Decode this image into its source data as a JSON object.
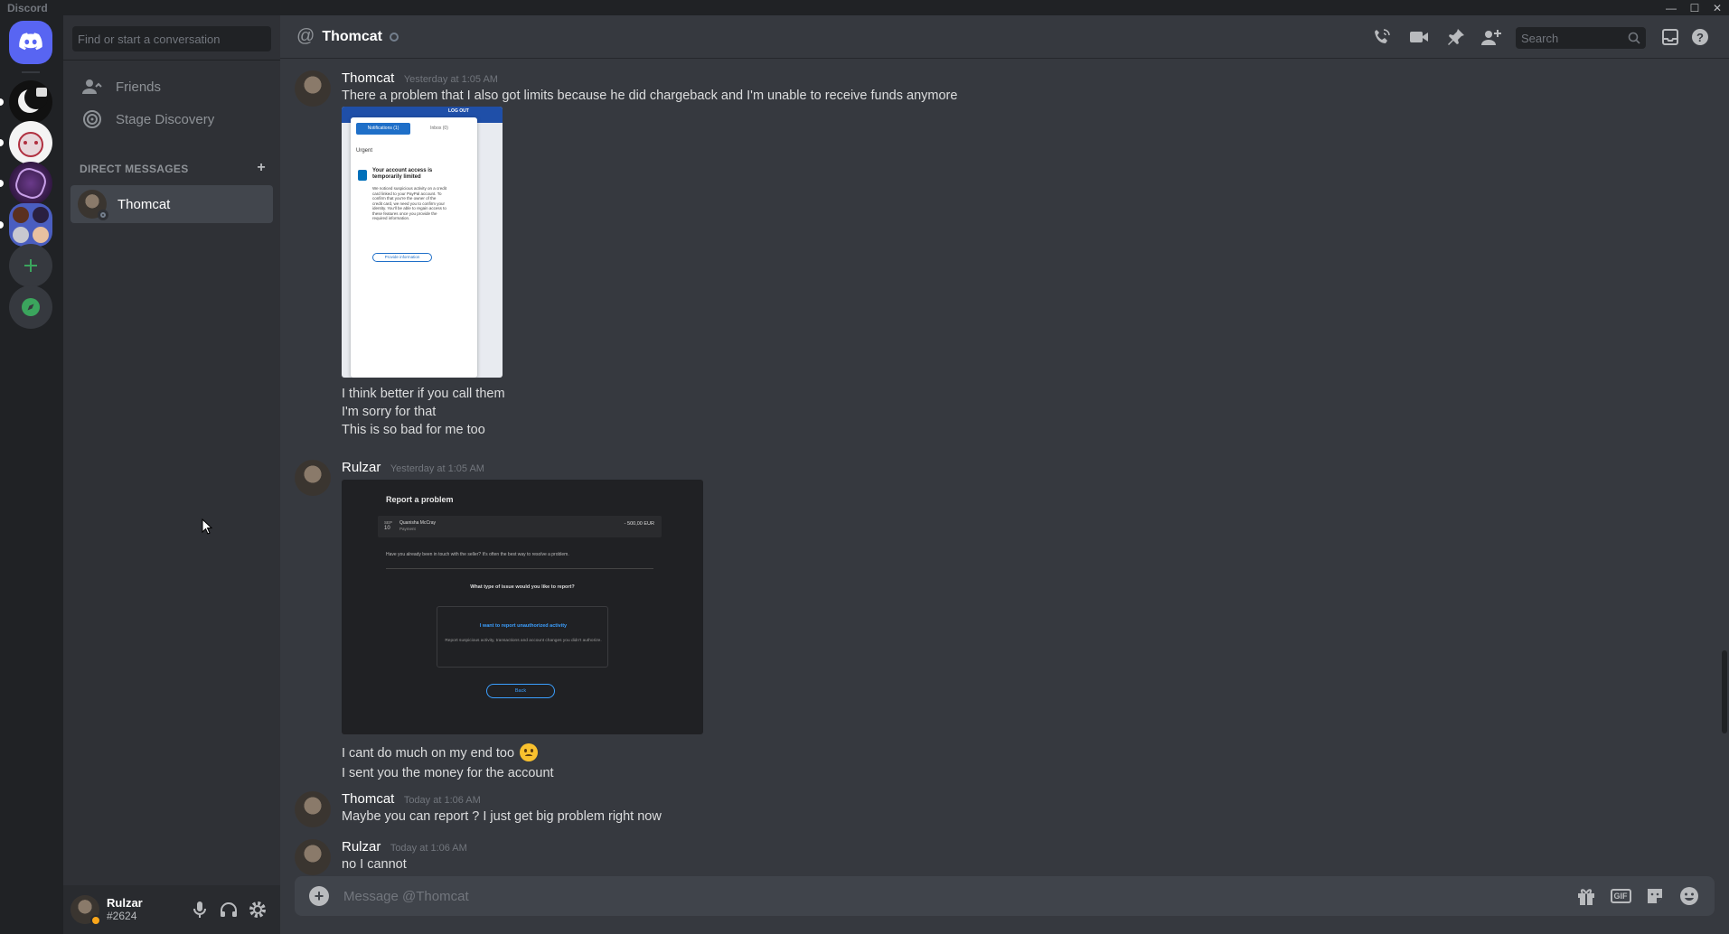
{
  "app": {
    "name": "Discord"
  },
  "guilds": {
    "items": [
      {
        "name": "home"
      },
      {
        "name": "server-moon"
      },
      {
        "name": "server-fox"
      },
      {
        "name": "server-purple"
      },
      {
        "name": "server-group"
      }
    ],
    "add_server_icon": "plus-icon",
    "explore_icon": "compass-icon"
  },
  "sidebar": {
    "search_placeholder": "Find or start a conversation",
    "nav": [
      {
        "label": "Friends",
        "icon": "friends-icon"
      },
      {
        "label": "Stage Discovery",
        "icon": "stage-icon"
      }
    ],
    "dm_header": "DIRECT MESSAGES",
    "dms": [
      {
        "name": "Thomcat",
        "status": "offline"
      }
    ]
  },
  "user": {
    "name": "Rulzar",
    "tag": "#2624"
  },
  "header": {
    "title": "Thomcat",
    "search_placeholder": "Search"
  },
  "messages": [
    {
      "author": "Thomcat",
      "time": "Yesterday at 1:05 AM",
      "lines": [
        "There a problem that I also got limits because he did chargeback and I'm unable to receive funds anymore"
      ],
      "attachment": {
        "tabs": [
          "Notifications (1)",
          "Inbox (0)"
        ],
        "logout": "LOG OUT",
        "section": "Urgent",
        "heading": "Your account access is temporarily limited",
        "body": "We noticed suspicious activity on a credit card linked to your PayPal account. To confirm that you're the owner of the credit card, we need you to confirm your identity. You'll be able to regain access to these features once you provide the required information.",
        "button": "Provide information"
      },
      "after_lines": [
        "I think better if you call them",
        "I'm sorry for that",
        "This is so bad for me too"
      ]
    },
    {
      "author": "Rulzar",
      "time": "Yesterday at 1:05 AM",
      "attachment": {
        "title": "Report a problem",
        "date_month": "SEP",
        "date_day": "10",
        "payee": "Quanisha McCray",
        "payee_sub": "Payment",
        "amount": "- 500,00 EUR",
        "question1": "Have you already been in touch with the seller? It's often the best way to resolve a problem.",
        "question2": "What type of issue would you like to report?",
        "option_title": "I want to report unauthorized activity",
        "option_desc": "Report suspicious activity, transactions and account changes you didn't authorize.",
        "button": "Back"
      },
      "after_lines": [
        "I cant do much on my end too",
        "I sent you the money for the account"
      ]
    },
    {
      "author": "Thomcat",
      "time": "Today at 1:06 AM",
      "lines": [
        "Maybe you can report ? I just get big problem right now"
      ]
    },
    {
      "author": "Rulzar",
      "time": "Today at 1:06 AM",
      "lines": [
        "no I cannot"
      ]
    }
  ],
  "composer": {
    "placeholder": "Message @Thomcat"
  },
  "colors": {
    "accent": "#5865f2",
    "green": "#3ba55d",
    "paypal_blue": "#0070ba"
  }
}
